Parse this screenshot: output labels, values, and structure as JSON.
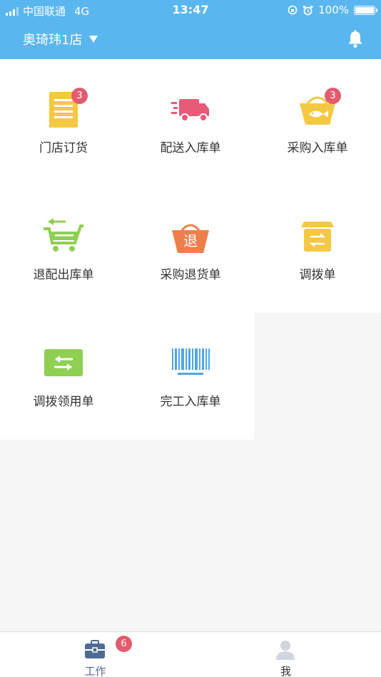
{
  "status_bar": {
    "carrier": "中国联通",
    "network": "4G",
    "time": "13:47",
    "battery": "100%"
  },
  "header": {
    "store_name": "奥琦玮1店",
    "background_color": "#5ab6ef"
  },
  "grid": {
    "items": [
      {
        "label": "门店订货",
        "icon": "order-document-icon",
        "badge": "3"
      },
      {
        "label": "配送入库单",
        "icon": "delivery-truck-icon"
      },
      {
        "label": "采购入库单",
        "icon": "fish-basket-icon",
        "badge": "3"
      },
      {
        "label": "退配出库单",
        "icon": "return-cart-icon"
      },
      {
        "label": "采购退货单",
        "icon": "return-basket-icon",
        "icon_text": "退"
      },
      {
        "label": "调拨单",
        "icon": "transfer-box-icon"
      },
      {
        "label": "调拨领用单",
        "icon": "transfer-arrows-icon"
      },
      {
        "label": "完工入库单",
        "icon": "barcode-icon"
      }
    ]
  },
  "tabbar": {
    "tabs": [
      {
        "label": "工作",
        "icon": "briefcase-icon",
        "badge": "6",
        "active": true
      },
      {
        "label": "我",
        "icon": "user-avatar-icon",
        "active": false
      }
    ]
  },
  "colors": {
    "badge": "#e25c6e",
    "tab_active": "#4f6a93",
    "tab_inactive": "#333333"
  }
}
